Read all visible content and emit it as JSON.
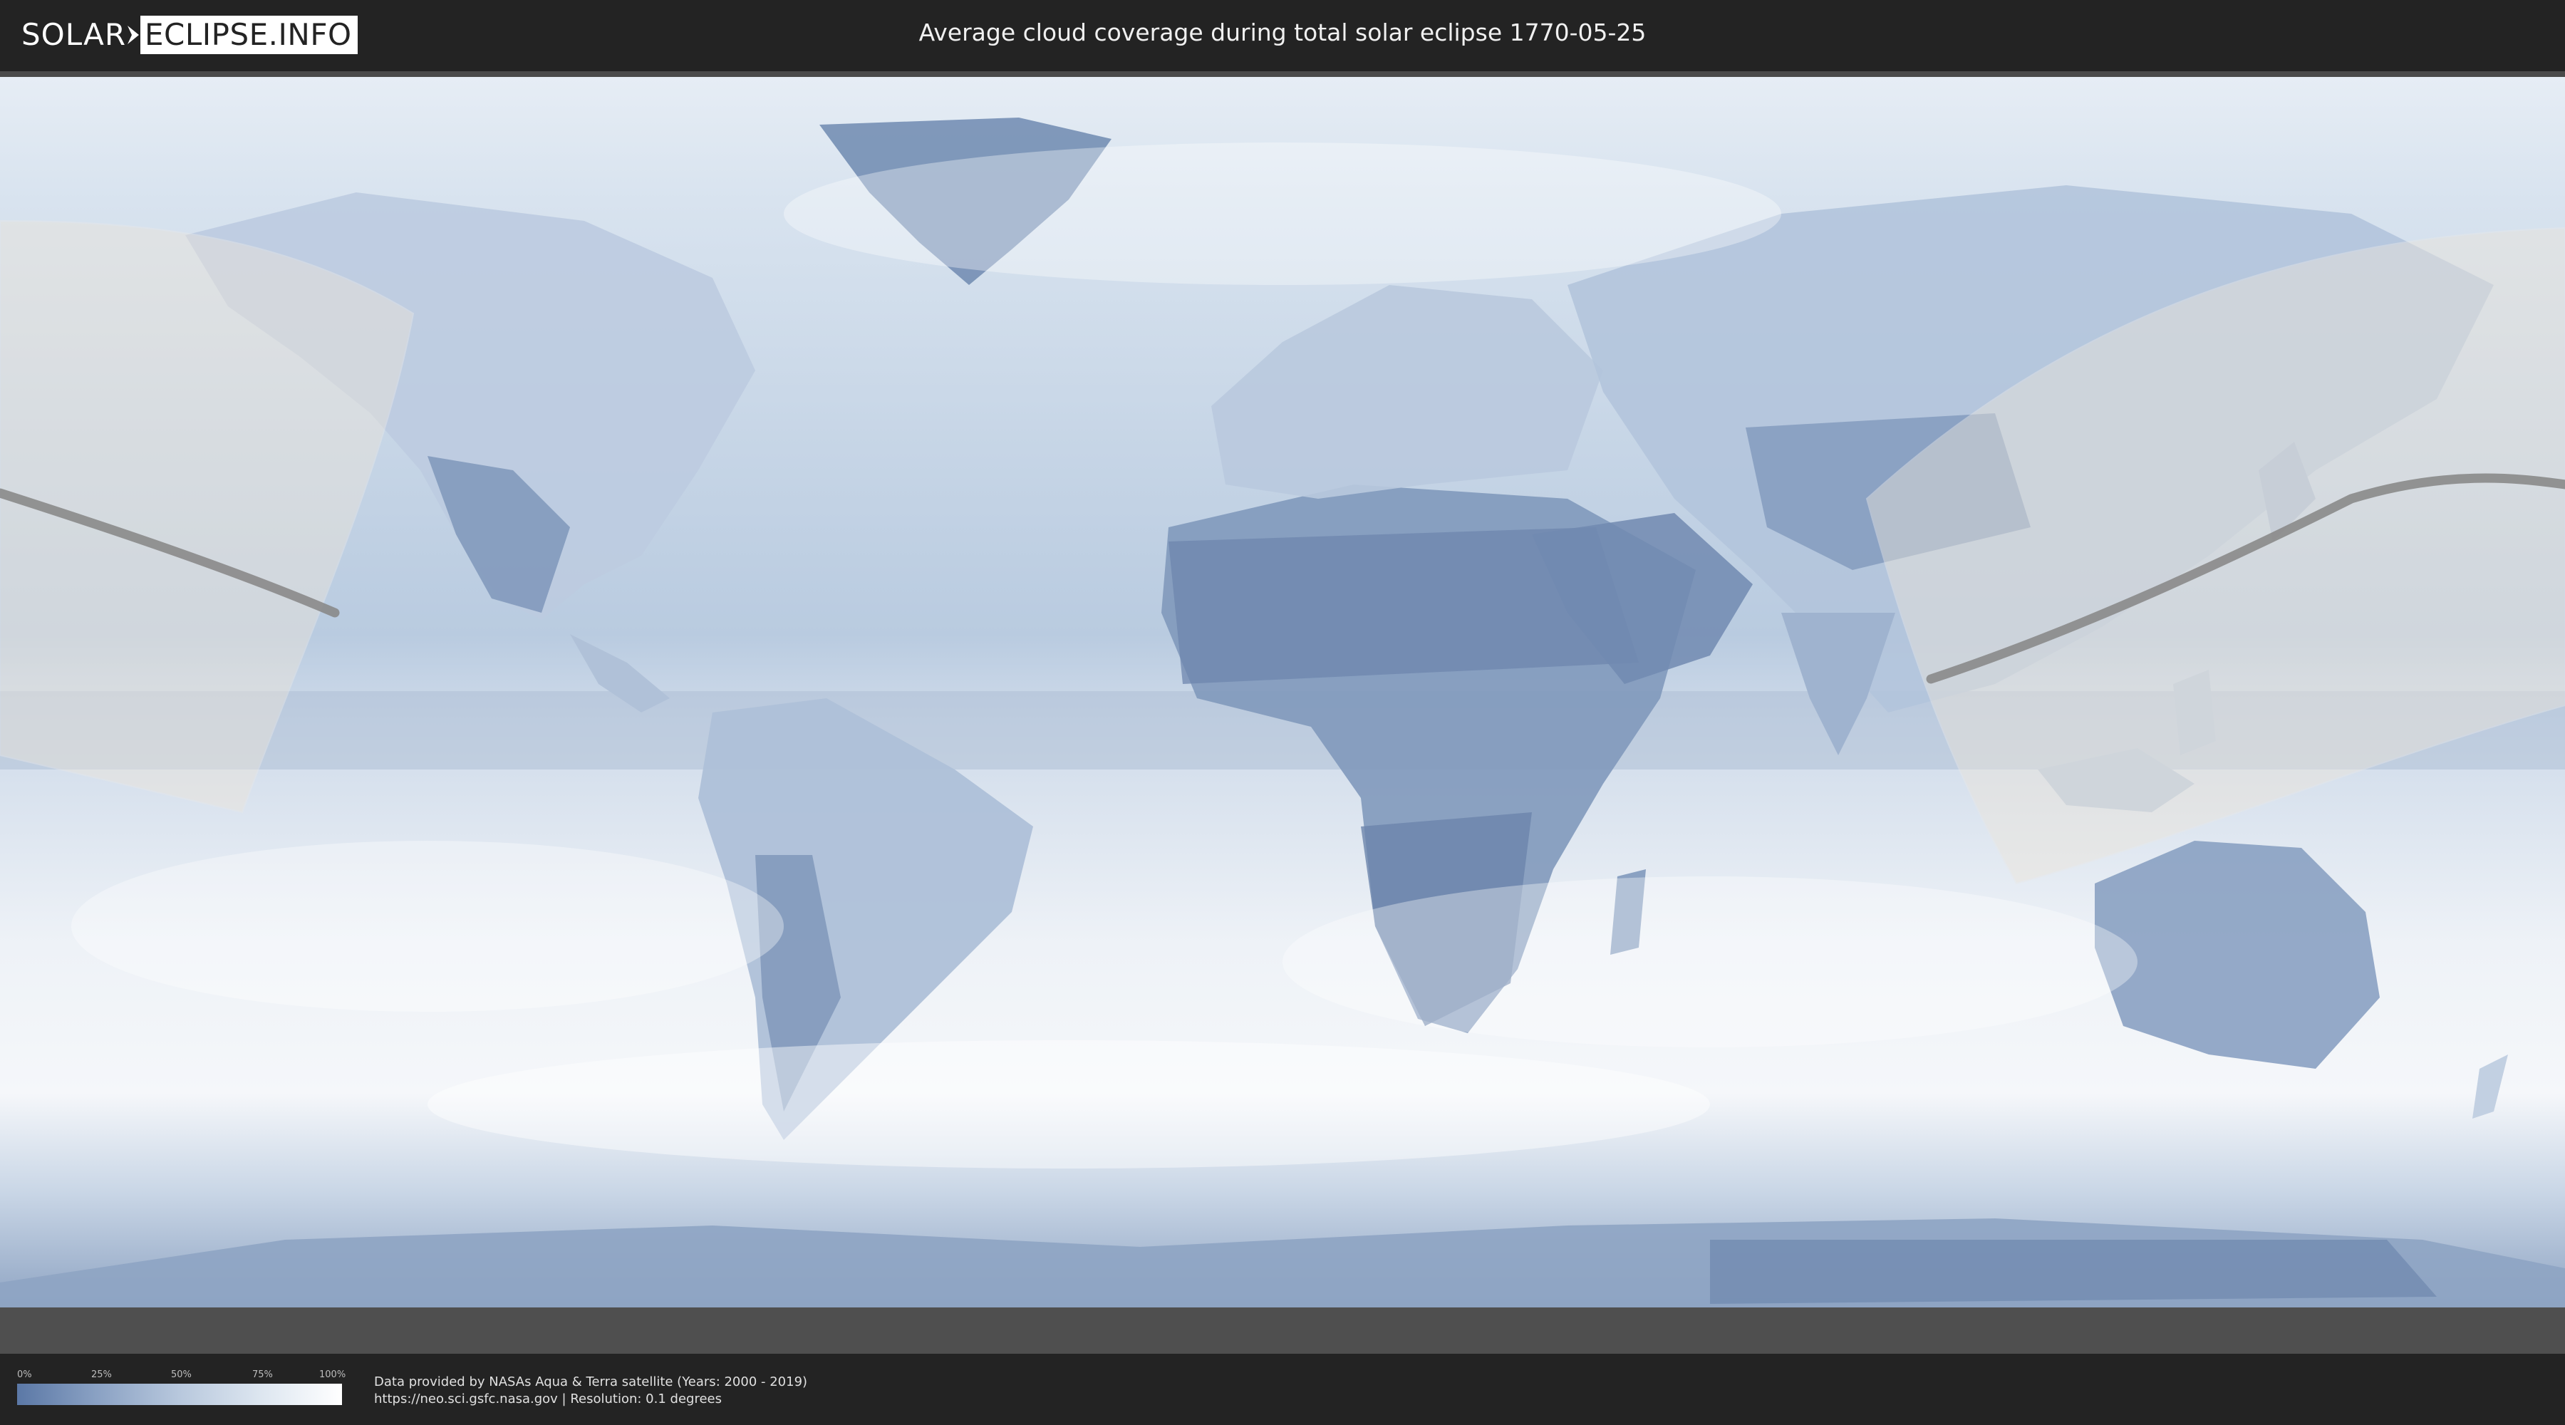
{
  "header": {
    "logo_left": "SOLAR",
    "logo_right": "ECLIPSE.INFO",
    "title": "Average cloud coverage during total solar eclipse 1770-05-25"
  },
  "map": {
    "description_icon": "world-cloud-map",
    "colors": {
      "clear": "#5b78a6",
      "cloudy": "#ffffff",
      "eclipse_path": "#8a8a8a",
      "visibility_shade": "#e9e4dc"
    }
  },
  "legend": {
    "ticks": [
      "0%",
      "25%",
      "50%",
      "75%",
      "100%"
    ]
  },
  "credits": {
    "line1": "Data provided by NASAs Aqua & Terra satellite (Years: 2000 - 2019)",
    "line2": "https://neo.sci.gsfc.nasa.gov | Resolution: 0.1 degrees"
  }
}
